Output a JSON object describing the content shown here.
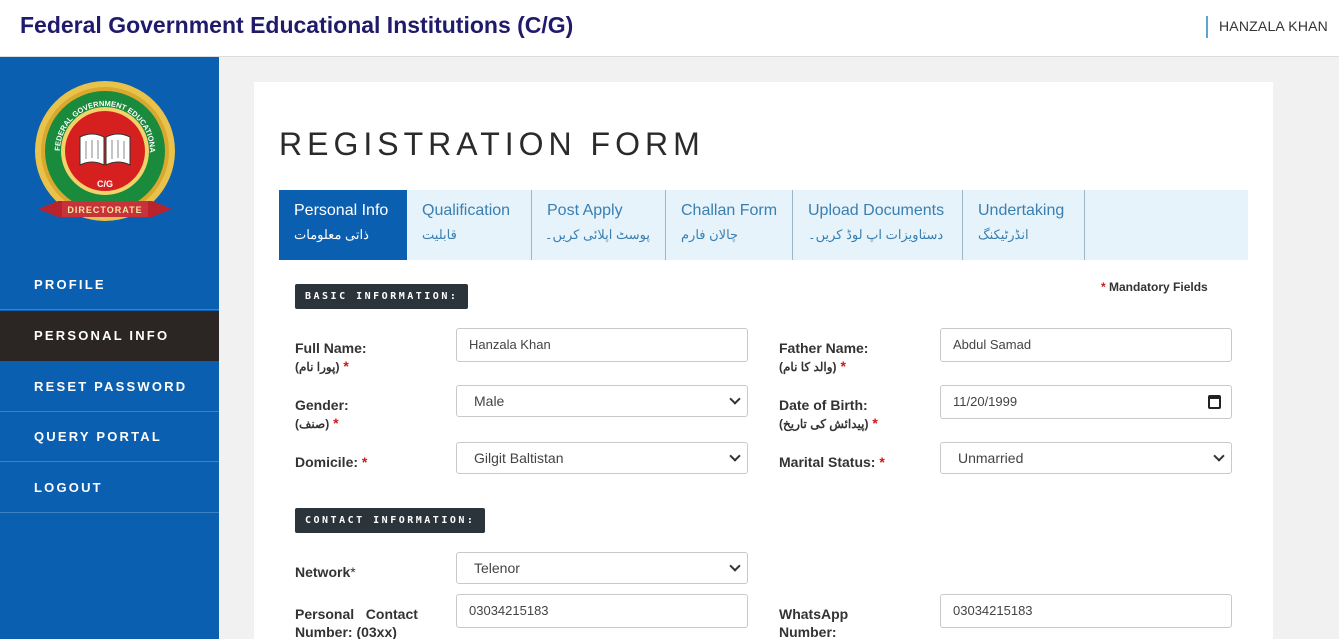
{
  "header": {
    "title": "Federal Government Educational Institutions (C/G)",
    "user": "HANZALA KHAN"
  },
  "logo": {
    "ring_text": "FEDERAL GOVERNMENT EDUCATIONAL INSTITUTIONS",
    "center_text": "C/G",
    "ribbon_text": "DIRECTORATE"
  },
  "sidebar": {
    "items": [
      {
        "label": "PROFILE"
      },
      {
        "label": "PERSONAL INFO"
      },
      {
        "label": "RESET PASSWORD"
      },
      {
        "label": "QUERY PORTAL"
      },
      {
        "label": "LOGOUT"
      }
    ],
    "active": "PERSONAL INFO"
  },
  "form": {
    "title": "REGISTRATION FORM",
    "tabs": [
      {
        "en": "Personal Info",
        "ur": "ذاتی معلومات"
      },
      {
        "en": "Qualification",
        "ur": "قابلیت"
      },
      {
        "en": "Post Apply",
        "ur": "پوسٹ اپلائی کریں۔"
      },
      {
        "en": "Challan Form",
        "ur": "چالان فارم"
      },
      {
        "en": "Upload Documents",
        "ur": "دستاویزات اپ لوڈ کریں۔"
      },
      {
        "en": "Undertaking",
        "ur": "انڈرٹیکنگ"
      }
    ],
    "mandatory_star": "*",
    "mandatory_text": "Mandatory Fields",
    "basic_title": "BASIC INFORMATION:",
    "contact_title": "CONTACT INFORMATION:",
    "fields": {
      "full_name": {
        "label": "Full Name:",
        "ur": "(پورا نام)",
        "value": "Hanzala Khan"
      },
      "father_name": {
        "label": "Father Name:",
        "ur": "(والد کا نام)",
        "value": "Abdul Samad"
      },
      "gender": {
        "label": "Gender:",
        "ur": "(صنف)",
        "value": "Male"
      },
      "dob": {
        "label": "Date of Birth:",
        "ur": "(پیدائش کی تاریخ)",
        "value": "11/20/1999"
      },
      "domicile": {
        "label": "Domicile:",
        "value": "Gilgit Baltistan"
      },
      "marital": {
        "label": "Marital Status:",
        "value": "Unmarried"
      },
      "network": {
        "label": "Network",
        "value": "Telenor"
      },
      "contact": {
        "label_line1": "Personal   Contact",
        "label_line2": "Number: (03xx)",
        "value": "03034215183"
      },
      "whatsapp": {
        "label_line1": "WhatsApp",
        "label_line2": "Number:",
        "value": "03034215183"
      }
    }
  },
  "colors": {
    "brand_blue": "#0a5fb0",
    "active_nav": "#2b2624",
    "title_navy": "#1f1a6b",
    "required_red": "#cc1a1a",
    "tab_bg": "#e6f3fb"
  }
}
